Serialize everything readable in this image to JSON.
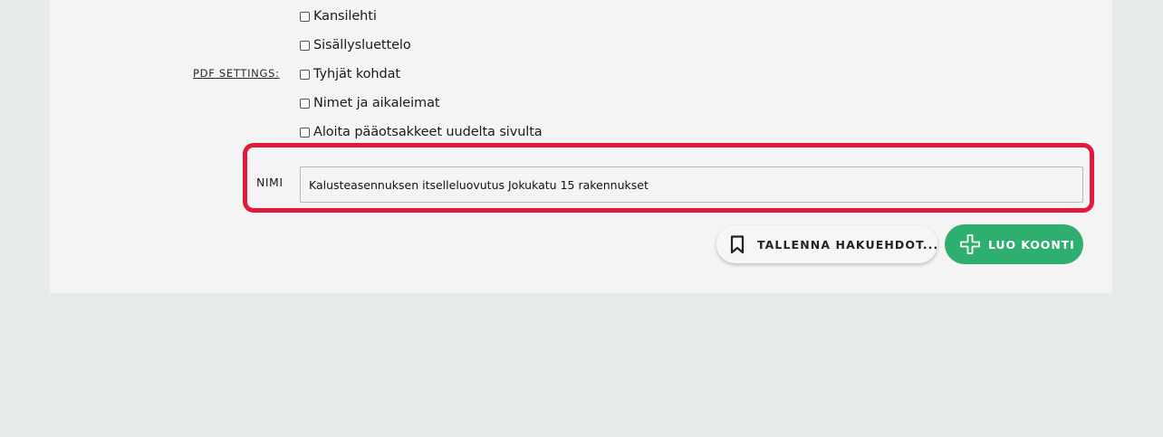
{
  "pdf_settings": {
    "label": "PDF SETTINGS:",
    "options": [
      {
        "label": "Kansilehti",
        "checked": false
      },
      {
        "label": "Sisällysluettelo",
        "checked": false
      },
      {
        "label": "Tyhjät kohdat",
        "checked": false
      },
      {
        "label": "Nimet ja aikaleimat",
        "checked": false
      },
      {
        "label": "Aloita pääotsakkeet uudelta sivulta",
        "checked": false
      }
    ]
  },
  "name_field": {
    "label": "NIMI",
    "value": "Kalusteasennuksen itselleluovutus Jokukatu 15 rakennukset"
  },
  "actions": {
    "save_search_label": "TALLENNA HAKUEHDOT...",
    "create_label": "LUO KOONTI"
  },
  "colors": {
    "highlight": "#e2183c",
    "primary_button": "#2eaf6f",
    "page_background": "#e8ebeb",
    "card_background": "#f4f4f4"
  },
  "icons": {
    "save_search": "bookmark-icon",
    "create": "plus-icon"
  }
}
